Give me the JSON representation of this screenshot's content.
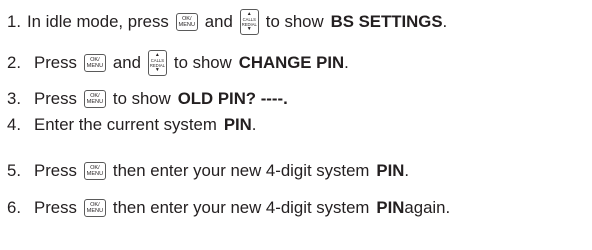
{
  "steps": [
    {
      "num": "1.",
      "t1": "In idle mode, press",
      "t2": "and",
      "t3": "to show",
      "bold": "BS SETTINGS",
      "end": "."
    },
    {
      "num": "2.",
      "t1": "Press",
      "t2": "and",
      "t3": "to show",
      "bold": "CHANGE PIN",
      "end": "."
    },
    {
      "num": "3.",
      "t1": "Press",
      "t2": "to show",
      "bold": "OLD PIN? ----."
    },
    {
      "num": "4.",
      "t1": "Enter the current system",
      "bold": "PIN",
      "end": "."
    },
    {
      "num": "5.",
      "t1": "Press",
      "t2": "then enter your new 4-digit system",
      "bold": "PIN",
      "end": "."
    },
    {
      "num": "6.",
      "t1": "Press",
      "t2": "then enter your new 4-digit system",
      "bold": "PIN",
      "end": " again."
    }
  ],
  "keys": {
    "ok_menu": {
      "line1": "OK/",
      "line2": "MENU",
      "icon": "ok-menu-key-icon"
    },
    "calls_redial": {
      "arrow_up": "▲",
      "line1": "CALLS",
      "line2": "REDIAL",
      "arrow_down": "▼",
      "icon": "calls-redial-key-icon"
    }
  }
}
